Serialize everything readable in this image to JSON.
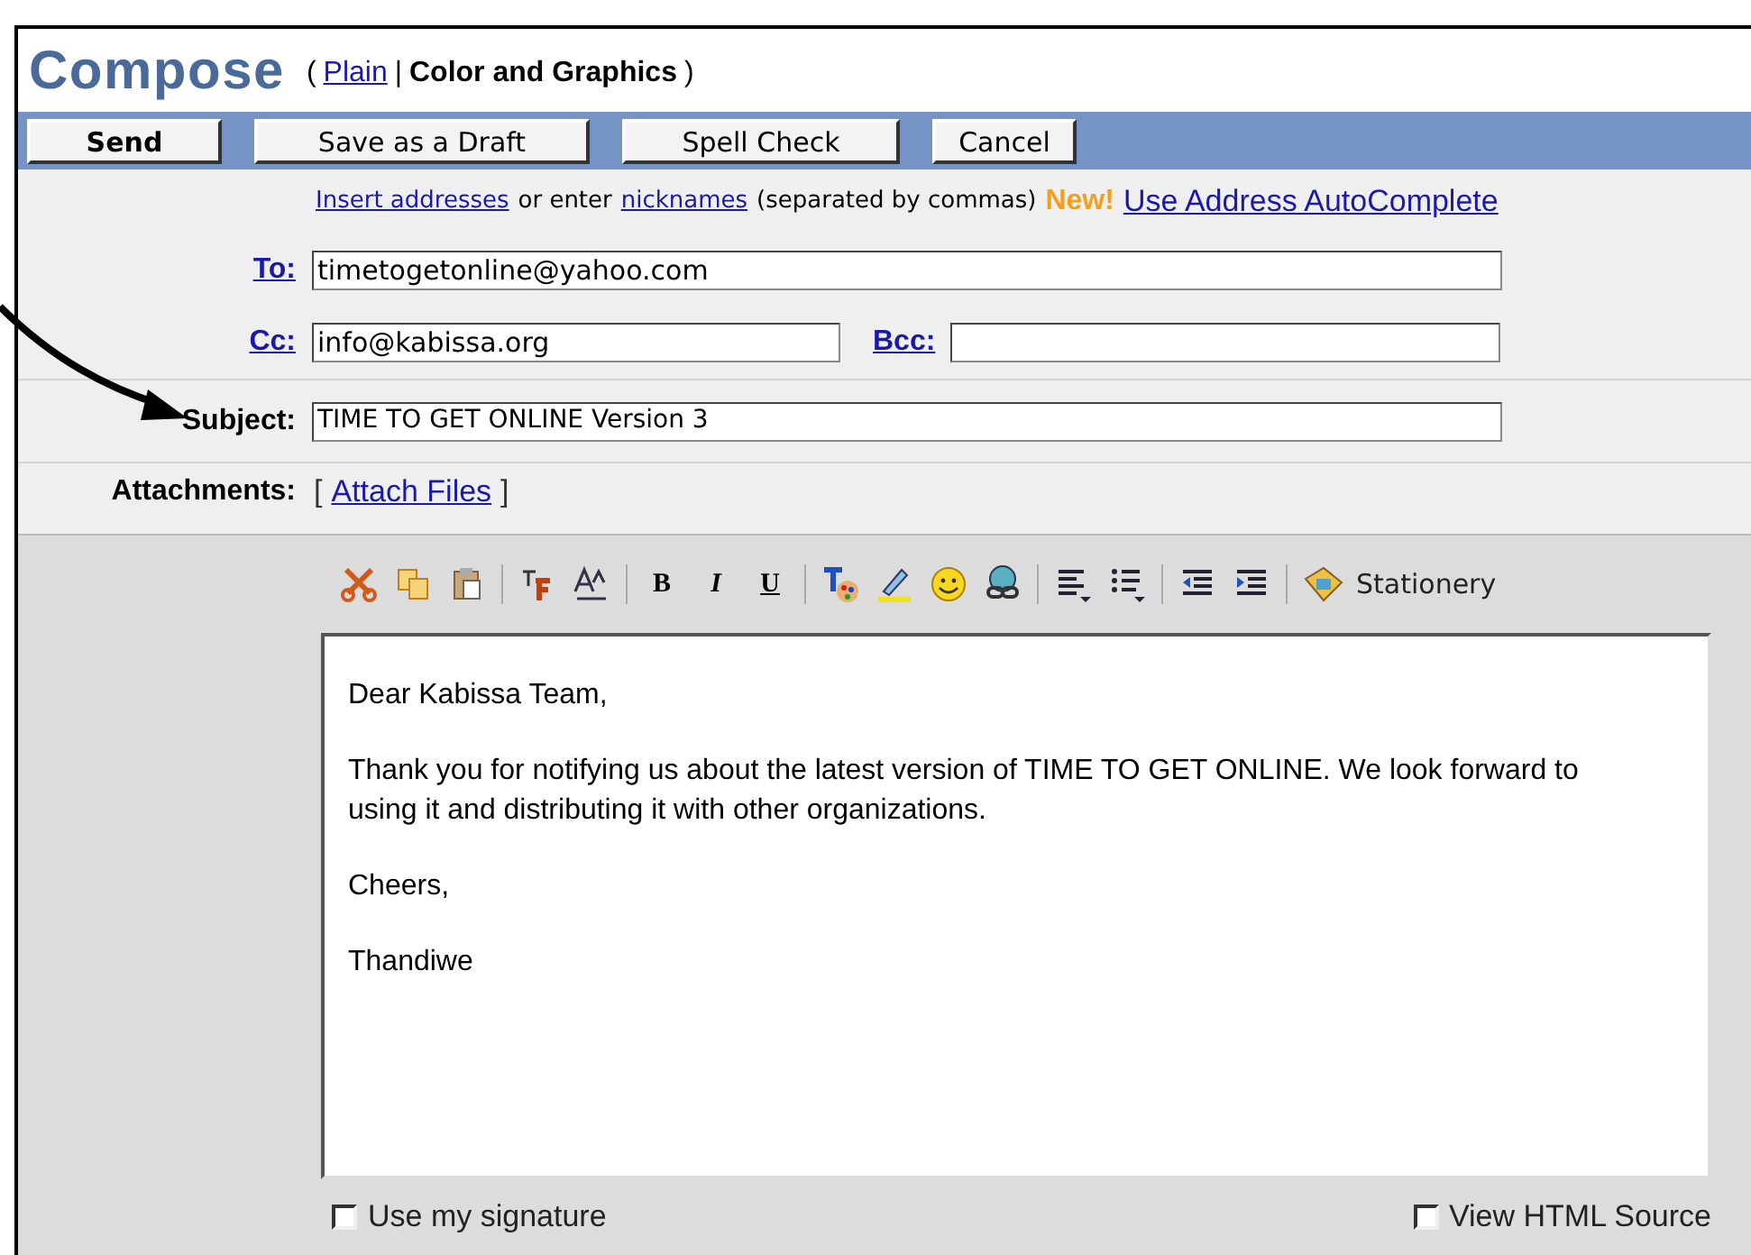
{
  "header": {
    "title": "Compose",
    "open_paren": "(",
    "plain_link": "Plain",
    "separator": "|",
    "current_mode": "Color and Graphics",
    "close_paren": ")"
  },
  "buttons": [
    {
      "label": "Send",
      "kind": "primary"
    },
    {
      "label": "Save as a Draft",
      "kind": "normal"
    },
    {
      "label": "Spell Check",
      "kind": "normal"
    },
    {
      "label": "Cancel",
      "kind": "normal"
    }
  ],
  "address_hint": {
    "insert_link": "Insert addresses",
    "or_enter": "or enter",
    "nicknames_link": "nicknames",
    "separated": "(separated by commas)",
    "new_badge": "New!",
    "autocomplete_link": "Use Address AutoComplete"
  },
  "to": {
    "label": "To:",
    "value": "timetogetonline@yahoo.com"
  },
  "cc": {
    "label": "Cc:",
    "value": "info@kabissa.org"
  },
  "bcc": {
    "label": "Bcc:"
  },
  "subject": {
    "label": "Subject:",
    "value": "TIME TO GET ONLINE Version 3"
  },
  "attachments": {
    "label": "Attachments:",
    "open_bracket": "[",
    "link": "Attach Files",
    "close_bracket": "]"
  },
  "format_toolbar": {
    "bold": "B",
    "italic": "I",
    "underline": "U",
    "stationery": "Stationery"
  },
  "message_body": [
    "Dear Kabissa Team,",
    "Thank you for notifying us about the latest version of TIME TO GET ONLINE.  We look forward to using it and distributing it with other organizations.",
    "Cheers,",
    "Thandiwe"
  ],
  "options": [
    {
      "label": "Use my signature",
      "checked": false
    },
    {
      "label": "View HTML Source",
      "checked": false
    }
  ]
}
